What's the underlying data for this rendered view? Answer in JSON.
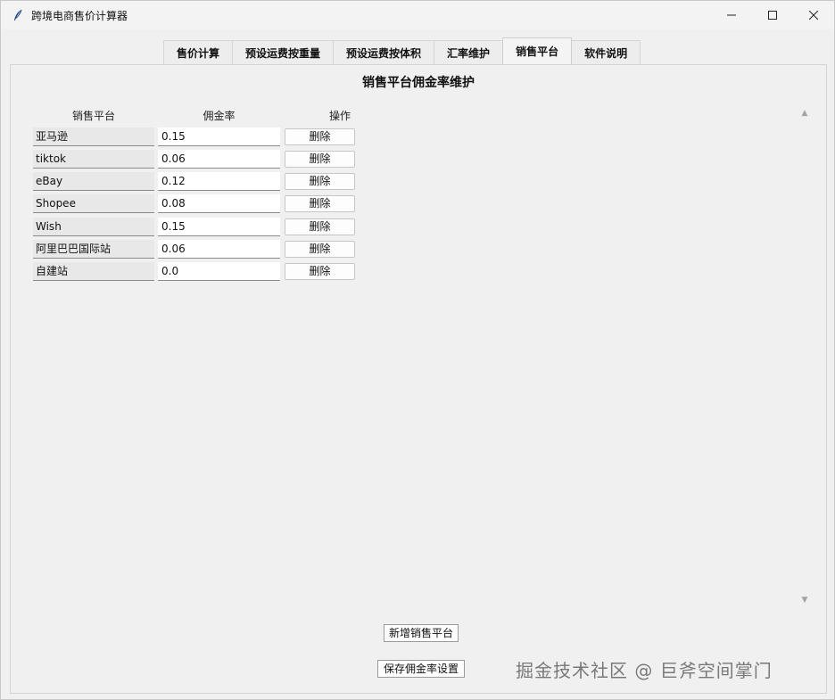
{
  "window": {
    "title": "跨境电商售价计算器",
    "icon": "feather-icon",
    "controls": {
      "minimize": "—",
      "maximize": "☐",
      "close": "✕"
    }
  },
  "tabs": [
    {
      "label": "售价计算",
      "active": false
    },
    {
      "label": "预设运费按重量",
      "active": false
    },
    {
      "label": "预设运费按体积",
      "active": false
    },
    {
      "label": "汇率维护",
      "active": false
    },
    {
      "label": "销售平台",
      "active": true
    },
    {
      "label": "软件说明",
      "active": false
    }
  ],
  "panel": {
    "title": "销售平台佣金率维护",
    "headers": {
      "platform": "销售平台",
      "rate": "佣金率",
      "action": "操作"
    },
    "rows": [
      {
        "platform": "亚马逊",
        "rate": "0.15",
        "action": "删除"
      },
      {
        "platform": "tiktok",
        "rate": "0.06",
        "action": "删除"
      },
      {
        "platform": "eBay",
        "rate": "0.12",
        "action": "删除"
      },
      {
        "platform": "Shopee",
        "rate": "0.08",
        "action": "删除"
      },
      {
        "platform": "Wish",
        "rate": "0.15",
        "action": "删除"
      },
      {
        "platform": "阿里巴巴国际站",
        "rate": "0.06",
        "action": "删除"
      },
      {
        "platform": "自建站",
        "rate": "0.0",
        "action": "删除"
      }
    ],
    "add_button": "新增销售平台",
    "save_button": "保存佣金率设置"
  },
  "watermark": "掘金技术社区 @ 巨斧空间掌门"
}
